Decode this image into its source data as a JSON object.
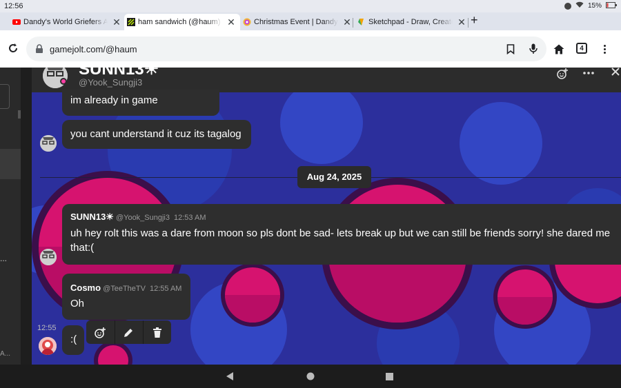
{
  "status": {
    "time": "12:56",
    "battery": "15%"
  },
  "tabs": [
    {
      "title": "Dandy's World Griefers Are I",
      "icon": "youtube-icon",
      "color": "#ff0000"
    },
    {
      "title": "ham sandwich (@haum) - G",
      "icon": "gamejolt-icon",
      "color": "#1d1d1d"
    },
    {
      "title": "Christmas Event | Dandy's W",
      "icon": "wiki-icon",
      "color": "#c23bd4"
    },
    {
      "title": "Sketchpad - Draw, Create, Sl",
      "icon": "sketchpad-icon",
      "color": "#f4a300"
    }
  ],
  "address": {
    "url": "gamejolt.com/@haum",
    "tab_count": "4"
  },
  "chat": {
    "header_name": "SUNN13☀",
    "header_handle": "@Yook_Sungji3",
    "date_divider": "Aug 24, 2025",
    "messages": [
      {
        "text": "im already in game"
      },
      {
        "text": "you cant understand it cuz its tagalog"
      },
      {
        "name": "SUNN13☀",
        "handle": "@Yook_Sungji3",
        "time": "12:53 AM",
        "text": "uh hey rolt this was a dare from moon so pls dont be sad- lets break up but we can still be friends sorry! she dared me that:("
      },
      {
        "name": "Cosmo",
        "handle": "@TeeTheTV",
        "time": "12:55 AM",
        "text": "Oh"
      },
      {
        "side_time": "12:55",
        "text": ":("
      }
    ]
  },
  "sidebar": {
    "ellipsis": "...",
    "truncated": "A..."
  }
}
